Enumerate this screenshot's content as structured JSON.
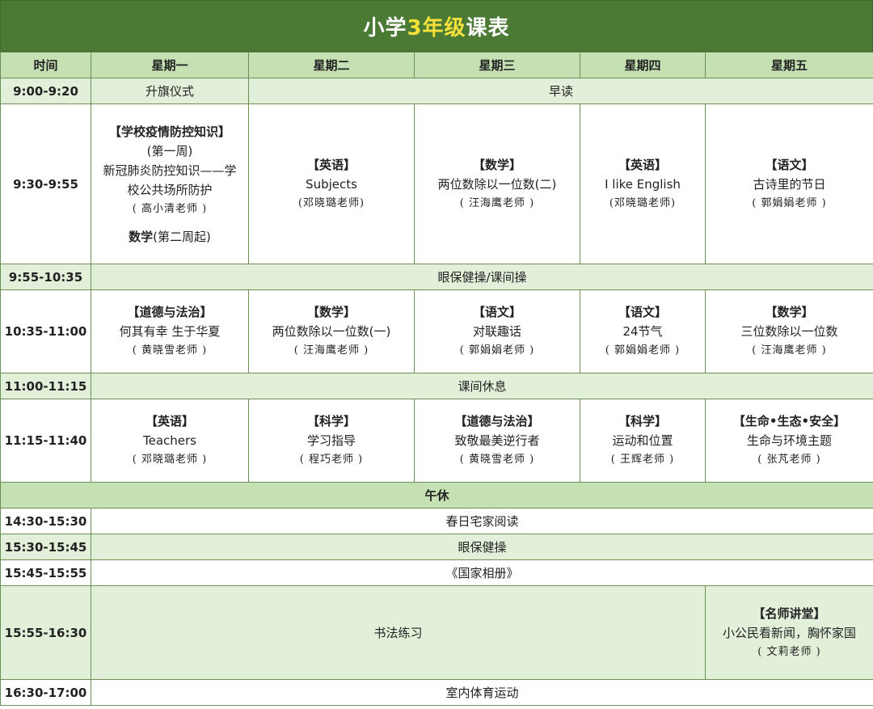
{
  "title": {
    "prefix": "小学",
    "grade": "3年级",
    "suffix": "课表"
  },
  "header": {
    "time": "时间",
    "days": [
      "星期一",
      "星期二",
      "星期三",
      "星期四",
      "星期五"
    ]
  },
  "rows": {
    "r1": {
      "time": "9:00-9:20",
      "mon": "升旗仪式",
      "rest": "早读"
    },
    "r2": {
      "time": "9:30-9:55",
      "mon": {
        "subject": "【学校疫情防控知识】",
        "week": "(第一周)",
        "topic1": "新冠肺炎防控知识——学",
        "topic2": "校公共场所防护",
        "teacher": "( 高小清老师 )",
        "note_bold": "数学",
        "note": "(第二周起)"
      },
      "tue": {
        "subject": "【英语】",
        "topic": "Subjects",
        "teacher": "(邓晓璐老师)"
      },
      "wed": {
        "subject": "【数学】",
        "topic": "两位数除以一位数(二)",
        "teacher": "( 汪海鹰老师 )"
      },
      "thu": {
        "subject": "【英语】",
        "topic": "I like English",
        "teacher": "(邓晓璐老师)"
      },
      "fri": {
        "subject": "【语文】",
        "topic": "古诗里的节日",
        "teacher": "( 郭娟娟老师 )"
      }
    },
    "r3": {
      "time": "9:55-10:35",
      "all": "眼保健操/课间操"
    },
    "r4": {
      "time": "10:35-11:00",
      "mon": {
        "subject": "【道德与法治】",
        "topic": "何其有幸 生于华夏",
        "teacher": "( 黄晓雪老师 )"
      },
      "tue": {
        "subject": "【数学】",
        "topic": "两位数除以一位数(一)",
        "teacher": "( 汪海鹰老师 )"
      },
      "wed": {
        "subject": "【语文】",
        "topic": "对联趣话",
        "teacher": "( 郭娟娟老师 )"
      },
      "thu": {
        "subject": "【语文】",
        "topic": "24节气",
        "teacher": "( 郭娟娟老师 )"
      },
      "fri": {
        "subject": "【数学】",
        "topic": "三位数除以一位数",
        "teacher": "( 汪海鹰老师 )"
      }
    },
    "r5": {
      "time": "11:00-11:15",
      "all": "课间休息"
    },
    "r6": {
      "time": "11:15-11:40",
      "mon": {
        "subject": "【英语】",
        "topic": "Teachers",
        "teacher": "( 邓晓璐老师 )"
      },
      "tue": {
        "subject": "【科学】",
        "topic": "学习指导",
        "teacher": "( 程巧老师 )"
      },
      "wed": {
        "subject": "【道德与法治】",
        "topic": "致敬最美逆行者",
        "teacher": "( 黄晓雪老师 )"
      },
      "thu": {
        "subject": "【科学】",
        "topic": "运动和位置",
        "teacher": "( 王辉老师 )"
      },
      "fri": {
        "subject": "【生命•生态•安全】",
        "topic": "生命与环境主题",
        "teacher": "( 张芃老师 )"
      }
    },
    "r7": {
      "all": "午休"
    },
    "r8": {
      "time": "14:30-15:30",
      "all": "春日宅家阅读"
    },
    "r9": {
      "time": "15:30-15:45",
      "all": "眼保健操"
    },
    "r10": {
      "time": "15:45-15:55",
      "all": "《国家相册》"
    },
    "r11": {
      "time": "15:55-16:30",
      "monthu": "书法练习",
      "fri": {
        "subject": "【名师讲堂】",
        "topic": "小公民看新闻，胸怀家国",
        "teacher": "( 文莉老师 )"
      }
    },
    "r12": {
      "time": "16:30-17:00",
      "all": "室内体育运动"
    }
  },
  "colors": {
    "title_bg": "#4a7a33",
    "title_highlight": "#f5e13a",
    "header_bg": "#c5e0b3",
    "band_bg": "#e2efd9",
    "border": "#6b8f55"
  }
}
